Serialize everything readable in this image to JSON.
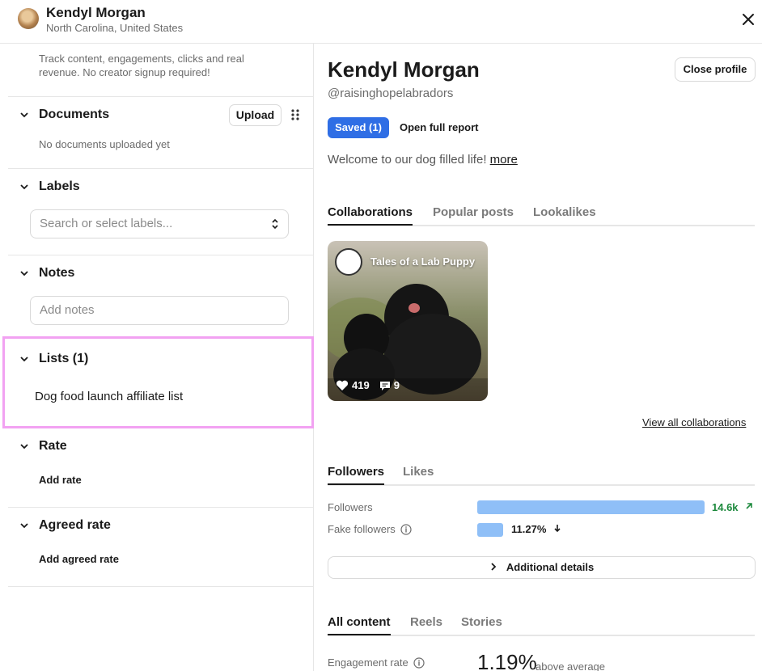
{
  "header": {
    "name": "Kendyl Morgan",
    "location": "North Carolina, United States"
  },
  "left": {
    "track_text": "Track content, engagements, clicks and real revenue. No creator signup required!",
    "documents": {
      "title": "Documents",
      "upload_label": "Upload",
      "empty_text": "No documents uploaded yet"
    },
    "labels": {
      "title": "Labels",
      "placeholder": "Search or select labels..."
    },
    "notes": {
      "title": "Notes",
      "placeholder": "Add notes"
    },
    "lists": {
      "title": "Lists (1)",
      "items": [
        "Dog food launch affiliate list"
      ]
    },
    "rate": {
      "title": "Rate",
      "add_label": "Add rate"
    },
    "agreed_rate": {
      "title": "Agreed rate",
      "add_label": "Add agreed rate"
    }
  },
  "right": {
    "name": "Kendyl Morgan",
    "handle": "@raisinghopelabradors",
    "close_profile_label": "Close profile",
    "saved_label": "Saved (1)",
    "open_report_label": "Open full report",
    "bio": "Welcome to our dog filled life!",
    "bio_more": "more",
    "collab_tabs": [
      "Collaborations",
      "Popular posts",
      "Lookalikes"
    ],
    "post": {
      "title": "Tales of a Lab Puppy",
      "likes": "419",
      "comments": "9"
    },
    "view_all_label": "View all collaborations",
    "follower_tabs": [
      "Followers",
      "Likes"
    ],
    "followers": {
      "label": "Followers",
      "value": "14.6k",
      "trend": "up",
      "bar_fraction": 1.0,
      "color": "#1e8a3e"
    },
    "fake_followers": {
      "label": "Fake followers",
      "value": "11.27%",
      "trend": "down",
      "bar_fraction": 0.1127
    },
    "additional_details_label": "Additional details",
    "content_tabs": [
      "All content",
      "Reels",
      "Stories"
    ],
    "engagement": {
      "label": "Engagement rate",
      "value": "1.19%",
      "sub": "above average"
    }
  },
  "colors": {
    "accent": "#2f6ee5",
    "bar": "#8fbff7",
    "highlight": "#f2a2f2",
    "positive": "#1e8a3e"
  }
}
